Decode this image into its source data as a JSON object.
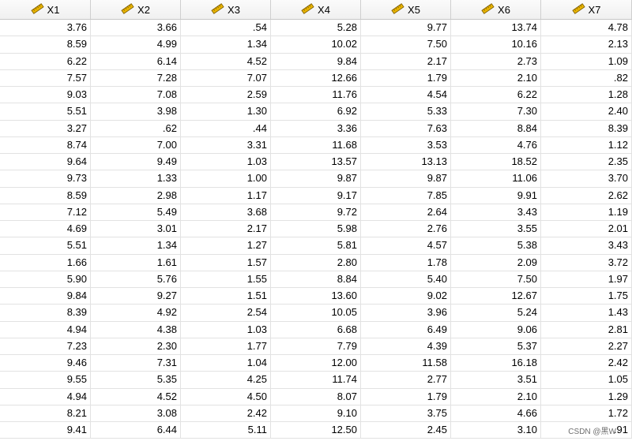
{
  "columns": [
    {
      "name": "X1",
      "icon": "ruler-icon"
    },
    {
      "name": "X2",
      "icon": "ruler-icon"
    },
    {
      "name": "X3",
      "icon": "ruler-icon"
    },
    {
      "name": "X4",
      "icon": "ruler-icon"
    },
    {
      "name": "X5",
      "icon": "ruler-icon"
    },
    {
      "name": "X6",
      "icon": "ruler-icon"
    },
    {
      "name": "X7",
      "icon": "ruler-icon"
    }
  ],
  "rows": [
    [
      "3.76",
      "3.66",
      ".54",
      "5.28",
      "9.77",
      "13.74",
      "4.78"
    ],
    [
      "8.59",
      "4.99",
      "1.34",
      "10.02",
      "7.50",
      "10.16",
      "2.13"
    ],
    [
      "6.22",
      "6.14",
      "4.52",
      "9.84",
      "2.17",
      "2.73",
      "1.09"
    ],
    [
      "7.57",
      "7.28",
      "7.07",
      "12.66",
      "1.79",
      "2.10",
      ".82"
    ],
    [
      "9.03",
      "7.08",
      "2.59",
      "11.76",
      "4.54",
      "6.22",
      "1.28"
    ],
    [
      "5.51",
      "3.98",
      "1.30",
      "6.92",
      "5.33",
      "7.30",
      "2.40"
    ],
    [
      "3.27",
      ".62",
      ".44",
      "3.36",
      "7.63",
      "8.84",
      "8.39"
    ],
    [
      "8.74",
      "7.00",
      "3.31",
      "11.68",
      "3.53",
      "4.76",
      "1.12"
    ],
    [
      "9.64",
      "9.49",
      "1.03",
      "13.57",
      "13.13",
      "18.52",
      "2.35"
    ],
    [
      "9.73",
      "1.33",
      "1.00",
      "9.87",
      "9.87",
      "11.06",
      "3.70"
    ],
    [
      "8.59",
      "2.98",
      "1.17",
      "9.17",
      "7.85",
      "9.91",
      "2.62"
    ],
    [
      "7.12",
      "5.49",
      "3.68",
      "9.72",
      "2.64",
      "3.43",
      "1.19"
    ],
    [
      "4.69",
      "3.01",
      "2.17",
      "5.98",
      "2.76",
      "3.55",
      "2.01"
    ],
    [
      "5.51",
      "1.34",
      "1.27",
      "5.81",
      "4.57",
      "5.38",
      "3.43"
    ],
    [
      "1.66",
      "1.61",
      "1.57",
      "2.80",
      "1.78",
      "2.09",
      "3.72"
    ],
    [
      "5.90",
      "5.76",
      "1.55",
      "8.84",
      "5.40",
      "7.50",
      "1.97"
    ],
    [
      "9.84",
      "9.27",
      "1.51",
      "13.60",
      "9.02",
      "12.67",
      "1.75"
    ],
    [
      "8.39",
      "4.92",
      "2.54",
      "10.05",
      "3.96",
      "5.24",
      "1.43"
    ],
    [
      "4.94",
      "4.38",
      "1.03",
      "6.68",
      "6.49",
      "9.06",
      "2.81"
    ],
    [
      "7.23",
      "2.30",
      "1.77",
      "7.79",
      "4.39",
      "5.37",
      "2.27"
    ],
    [
      "9.46",
      "7.31",
      "1.04",
      "12.00",
      "11.58",
      "16.18",
      "2.42"
    ],
    [
      "9.55",
      "5.35",
      "4.25",
      "11.74",
      "2.77",
      "3.51",
      "1.05"
    ],
    [
      "4.94",
      "4.52",
      "4.50",
      "8.07",
      "1.79",
      "2.10",
      "1.29"
    ],
    [
      "8.21",
      "3.08",
      "2.42",
      "9.10",
      "3.75",
      "4.66",
      "1.72"
    ],
    [
      "9.41",
      "6.44",
      "5.11",
      "12.50",
      "2.45",
      "3.10",
      ".91"
    ]
  ],
  "watermark": "CSDN @黑W",
  "colors": {
    "ruler_fill": "#e8b400",
    "ruler_stroke": "#7a5a00",
    "grid_line": "#e2e2e2",
    "header_bg": "#f4f4f4"
  }
}
